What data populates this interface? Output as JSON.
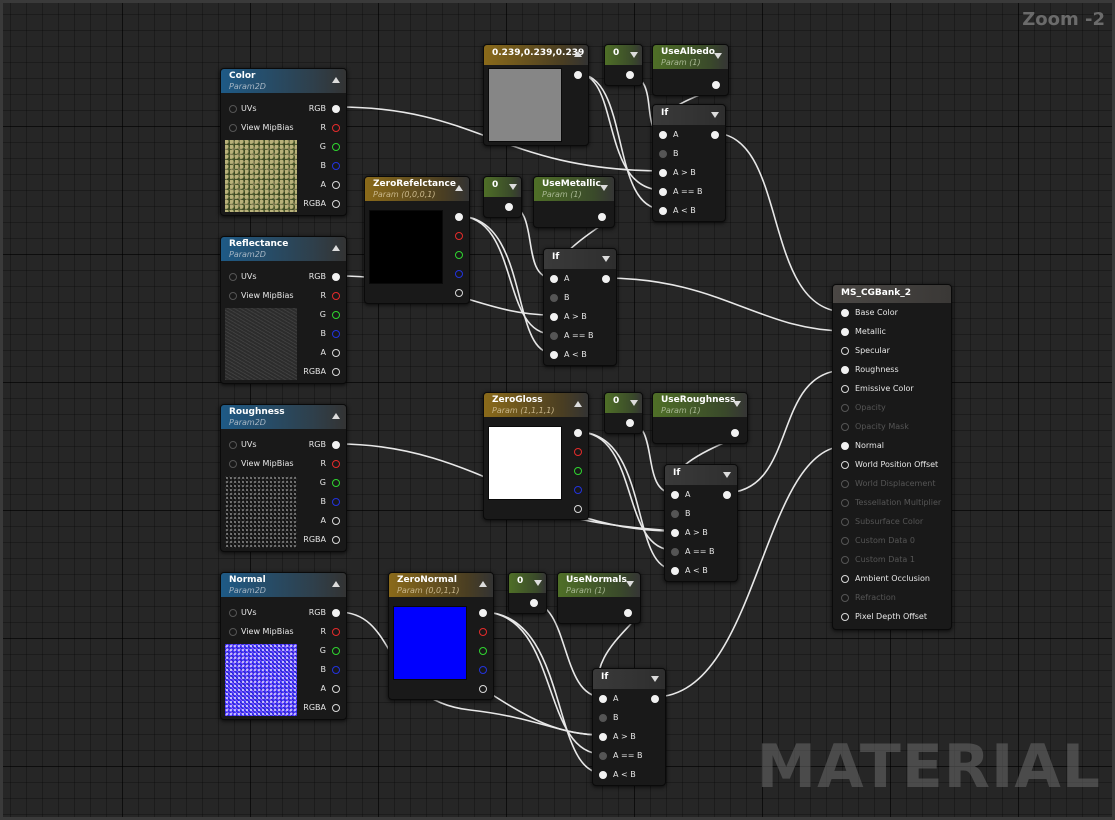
{
  "zoom_label": "Zoom -2",
  "watermark": "MATERIAL",
  "texture_nodes": {
    "color": {
      "title": "Color",
      "subtitle": "Param2D"
    },
    "reflectance": {
      "title": "Reflectance",
      "subtitle": "Param2D"
    },
    "roughness": {
      "title": "Roughness",
      "subtitle": "Param2D"
    },
    "normal": {
      "title": "Normal",
      "subtitle": "Param2D"
    },
    "inputs": {
      "uvs": "UVs",
      "mipbias": "View MipBias"
    },
    "outputs": {
      "rgb": "RGB",
      "r": "R",
      "g": "G",
      "b": "B",
      "a": "A",
      "rgba": "RGBA"
    }
  },
  "vector_nodes": {
    "albedo_const": {
      "title": "0.239,0.239,0.239",
      "color": "#868686"
    },
    "zero_reflectance": {
      "title": "ZeroRefelctance",
      "subtitle": "Param (0,0,0,1)",
      "color": "#000000"
    },
    "zero_gloss": {
      "title": "ZeroGloss",
      "subtitle": "Param (1,1,1,1)",
      "color": "#ffffff"
    },
    "zero_normal": {
      "title": "ZeroNormal",
      "subtitle": "Param (0,0,1,1)",
      "color": "#0000ff"
    }
  },
  "constants": {
    "c1": "0",
    "c2": "0",
    "c3": "0",
    "c4": "0"
  },
  "scalar_params": {
    "use_albedo": {
      "title": "UseAlbedo",
      "subtitle": "Param (1)"
    },
    "use_metallic": {
      "title": "UseMetallic",
      "subtitle": "Param (1)"
    },
    "use_roughness": {
      "title": "UseRoughness",
      "subtitle": "Param (1)"
    },
    "use_normals": {
      "title": "UseNormals",
      "subtitle": "Param (1)"
    }
  },
  "if_node": {
    "title": "If",
    "pins": [
      "A",
      "B",
      "A > B",
      "A == B",
      "A < B"
    ]
  },
  "material": {
    "title": "MS_CGBank_2",
    "pins": [
      "Base Color",
      "Metallic",
      "Specular",
      "Roughness",
      "Emissive Color",
      "Opacity",
      "Opacity Mask",
      "Normal",
      "World Position Offset",
      "World Displacement",
      "Tessellation Multiplier",
      "Subsurface Color",
      "Custom Data 0",
      "Custom Data 1",
      "Ambient Occlusion",
      "Refraction",
      "Pixel Depth Offset"
    ]
  },
  "colors": {
    "wire": "#e8e8e8",
    "accent_blue": "#1e5a86",
    "accent_gold": "#8a6a1a",
    "accent_green": "#4f6f27"
  }
}
